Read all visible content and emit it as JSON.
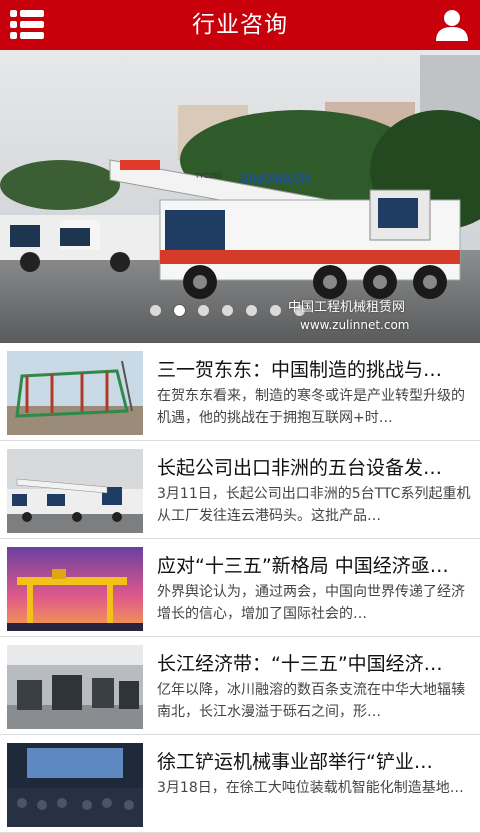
{
  "header": {
    "title": "行业咨询",
    "menu_icon": "list-menu-icon",
    "user_icon": "user-icon",
    "bg_color": "#c8000b"
  },
  "banner": {
    "watermark_cn": "中国工程机械租赁网",
    "watermark_url": "www.zulinnet.com",
    "crane_brand": "SINOMACH",
    "crane_model": "TYC25G",
    "dots_total": 7,
    "active_dot": 2
  },
  "articles": [
    {
      "title": "三一贺东东：中国制造的挑战与…",
      "desc": "在贺东东看来，制造的寒冬或许是产业转型升级的机遇，他的挑战在于拥抱互联网+时…"
    },
    {
      "title": "长起公司出口非洲的五台设备发…",
      "desc": "3月11日，长起公司出口非洲的5台TTC系列起重机从工厂发往连云港码头。这批产品…"
    },
    {
      "title": "应对“十三五”新格局 中国经济亟…",
      "desc": "外界舆论认为，通过两会，中国向世界传递了经济增长的信心，增加了国际社会的…"
    },
    {
      "title": "长江经济带：“十三五”中国经济…",
      "desc": "亿年以降，冰川融溶的数百条支流在中华大地辐辏南北，长江水漫溢于砾石之间，形…"
    },
    {
      "title": "徐工铲运机械事业部举行“铲业…",
      "desc": "3月18日，在徐工大吨位装载机智能化制造基地…"
    }
  ]
}
